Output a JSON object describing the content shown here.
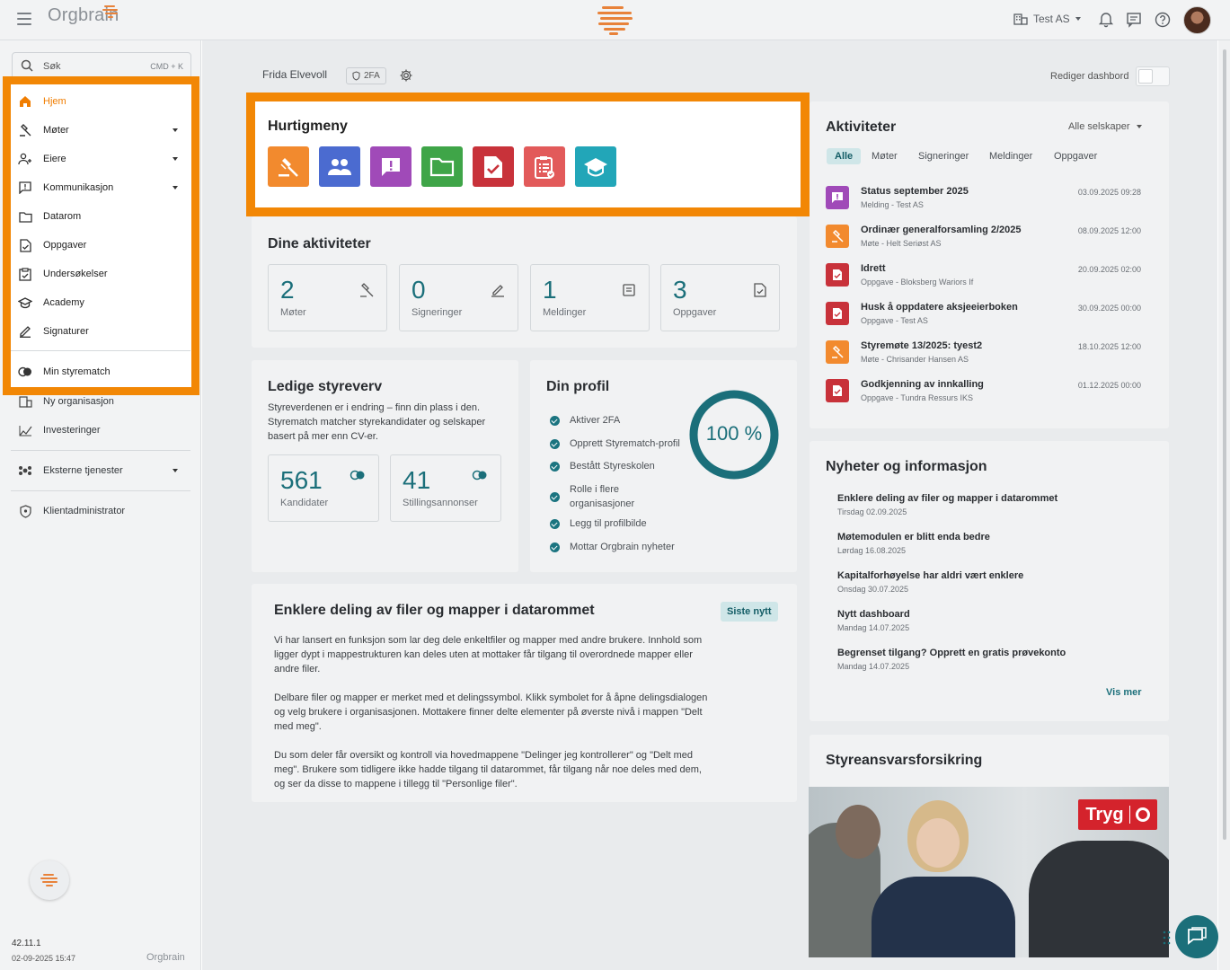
{
  "topbar": {
    "brand": "Orgbrain",
    "company": "Test AS"
  },
  "sidebar": {
    "search_label": "Søk",
    "search_shortcut": "CMD + K",
    "items": [
      {
        "label": "Hjem"
      },
      {
        "label": "Møter"
      },
      {
        "label": "Eiere"
      },
      {
        "label": "Kommunikasjon"
      },
      {
        "label": "Datarom"
      },
      {
        "label": "Oppgaver"
      },
      {
        "label": "Undersøkelser"
      },
      {
        "label": "Academy"
      },
      {
        "label": "Signaturer"
      },
      {
        "label": "Min styrematch"
      },
      {
        "label": "Ny organisasjon"
      },
      {
        "label": "Investeringer"
      },
      {
        "label": "Eksterne tjenester"
      },
      {
        "label": "Klientadministrator"
      }
    ],
    "version": "42.11.1",
    "build_date": "02-09-2025 15:47",
    "footer_brand": "Orgbrain"
  },
  "header": {
    "user_name": "Frida Elvevoll",
    "twofa_badge": "2FA",
    "edit_dashboard": "Rediger dashbord"
  },
  "quickmenu": {
    "title": "Hurtigmeny",
    "buttons": [
      {
        "icon": "gavel-icon",
        "color": "#f28a2e"
      },
      {
        "icon": "people-icon",
        "color": "#4b6bd0"
      },
      {
        "icon": "message-alert-icon",
        "color": "#a04ab8"
      },
      {
        "icon": "folder-icon",
        "color": "#3fa548"
      },
      {
        "icon": "task-check-icon",
        "color": "#c8323a"
      },
      {
        "icon": "survey-icon",
        "color": "#e25a5a"
      },
      {
        "icon": "academy-icon",
        "color": "#22a6b8"
      }
    ]
  },
  "activities_card": {
    "title": "Dine aktiviteter",
    "stats": [
      {
        "value": "2",
        "label": "Møter"
      },
      {
        "value": "0",
        "label": "Signeringer"
      },
      {
        "value": "1",
        "label": "Meldinger"
      },
      {
        "value": "3",
        "label": "Oppgaver"
      }
    ]
  },
  "board_card": {
    "title": "Ledige styreverv",
    "text": "Styreverdenen er i endring – finn din plass i den. Styrematch matcher styrekandidater og selskaper basert på mer enn CV-er.",
    "stats": [
      {
        "value": "561",
        "label": "Kandidater"
      },
      {
        "value": "41",
        "label": "Stillingsannonser"
      }
    ]
  },
  "profile_card": {
    "title": "Din profil",
    "percent": "100 %",
    "progress": 1.0,
    "items": [
      "Aktiver 2FA",
      "Opprett Styrematch-profil",
      "Bestått Styreskolen",
      "Rolle i flere organisasjoner",
      "Legg til profilbilde",
      "Mottar Orgbrain nyheter"
    ]
  },
  "article": {
    "title": "Enklere deling av filer og mapper i datarommet",
    "badge": "Siste nytt",
    "p1": "Vi har lansert en funksjon som lar deg dele enkeltfiler og mapper med andre brukere. Innhold som ligger dypt i mappestrukturen kan deles uten at mottaker får tilgang til overordnede mapper eller andre filer.",
    "p2": "Delbare filer og mapper er merket med et delingssymbol. Klikk symbolet for å åpne delingsdialogen og velg brukere i organisasjonen. Mottakere finner delte elementer på øverste nivå i mappen \"Delt med meg\".",
    "p3": "Du som deler får oversikt og kontroll via hovedmappene \"Delinger jeg kontrollerer\" og \"Delt med meg\". Brukere som tidligere ikke hadde tilgang til datarommet, får tilgang når noe deles med dem, og ser da disse to mappene i tillegg til \"Personlige filer\"."
  },
  "aktiviteter": {
    "title": "Aktiviteter",
    "filter": "Alle selskaper",
    "tabs": [
      "Alle",
      "Møter",
      "Signeringer",
      "Meldinger",
      "Oppgaver"
    ],
    "rows": [
      {
        "title": "Status september 2025",
        "sub": "Melding - Test AS",
        "date": "03.09.2025 09:28",
        "kind": "message",
        "color": "#a04ab8"
      },
      {
        "title": "Ordinær generalforsamling 2/2025",
        "sub": "Møte - Helt Seriøst AS",
        "date": "08.09.2025 12:00",
        "kind": "meeting",
        "color": "#f28a2e"
      },
      {
        "title": "Idrett",
        "sub": "Oppgave - Bloksberg Wariors If",
        "date": "20.09.2025 02:00",
        "kind": "task",
        "color": "#c8323a"
      },
      {
        "title": "Husk å oppdatere aksjeeierboken",
        "sub": "Oppgave - Test AS",
        "date": "30.09.2025 00:00",
        "kind": "task",
        "color": "#c8323a"
      },
      {
        "title": "Styremøte 13/2025: tyest2",
        "sub": "Møte - Chrisander Hansen AS",
        "date": "18.10.2025 12:00",
        "kind": "meeting",
        "color": "#f28a2e"
      },
      {
        "title": "Godkjenning av innkalling",
        "sub": "Oppgave - Tundra Ressurs IKS",
        "date": "01.12.2025 00:00",
        "kind": "task",
        "color": "#c8323a"
      }
    ]
  },
  "news": {
    "title": "Nyheter og informasjon",
    "items": [
      {
        "title": "Enklere deling av filer og mapper i datarommet",
        "date": "Tirsdag 02.09.2025"
      },
      {
        "title": "Møtemodulen er blitt enda bedre",
        "date": "Lørdag 16.08.2025"
      },
      {
        "title": "Kapitalforhøyelse har aldri vært enklere",
        "date": "Onsdag 30.07.2025"
      },
      {
        "title": "Nytt dashboard",
        "date": "Mandag 14.07.2025"
      },
      {
        "title": "Begrenset tilgang? Opprett en gratis prøvekonto",
        "date": "Mandag 14.07.2025"
      }
    ],
    "more": "Vis mer"
  },
  "insurance": {
    "title": "Styreansvarsforsikring",
    "logo_text": "Tryg"
  }
}
